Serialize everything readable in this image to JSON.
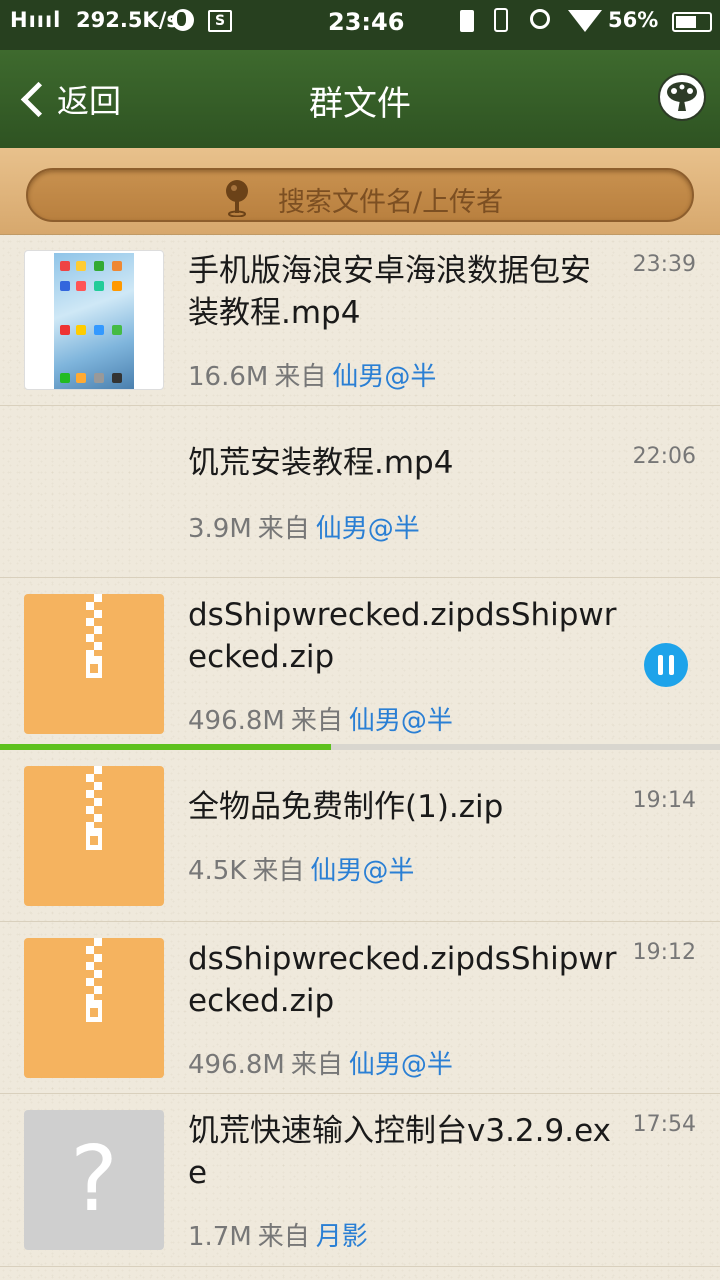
{
  "status_bar": {
    "network": "H",
    "net_speed": "292.5K/s",
    "sim_badge": "S",
    "time": "23:46",
    "battery_percent": "56%",
    "icons": [
      "signal-icon",
      "globe-icon",
      "sim-icon",
      "charging-icon",
      "vibrate-icon",
      "alarm-icon",
      "wifi-icon",
      "battery-icon"
    ]
  },
  "header": {
    "back_label": "返回",
    "title": "群文件",
    "right_icon": "tree-icon"
  },
  "search": {
    "placeholder": "搜索文件名/上传者",
    "icon": "location-pin-icon"
  },
  "files": [
    {
      "thumb": "video",
      "name": "手机版海浪安卓海浪数据包安装教程.mp4",
      "size": "16.6M",
      "from_label": "来自",
      "uploader": "仙男@半",
      "time": "23:39"
    },
    {
      "thumb": "none",
      "name": "饥荒安装教程.mp4",
      "size": "3.9M",
      "from_label": "来自",
      "uploader": "仙男@半",
      "time": "22:06"
    },
    {
      "thumb": "zip",
      "name": "dsShipwrecked.zipdsShipwrecked.zip",
      "size": "496.8M",
      "from_label": "来自",
      "uploader": "仙男@半",
      "time": "",
      "downloading": true,
      "progress": 0.46
    },
    {
      "thumb": "zip",
      "name": "全物品免费制作(1).zip",
      "size": "4.5K",
      "from_label": "来自",
      "uploader": "仙男@半",
      "time": "19:14"
    },
    {
      "thumb": "zip",
      "name": "dsShipwrecked.zipdsShipwrecked.zip",
      "size": "496.8M",
      "from_label": "来自",
      "uploader": "仙男@半",
      "time": "19:12"
    },
    {
      "thumb": "unknown",
      "name": "饥荒快速输入控制台v3.2.9.exe",
      "size": "1.7M",
      "from_label": "来自",
      "uploader": "月影",
      "time": "17:54"
    }
  ],
  "colors": {
    "titlebar": "#3e6a2e",
    "uploader_link": "#2a7fd4",
    "zip_thumb": "#f5b35f",
    "progress": "#5ec11e",
    "pause_button": "#1ea3ea"
  }
}
